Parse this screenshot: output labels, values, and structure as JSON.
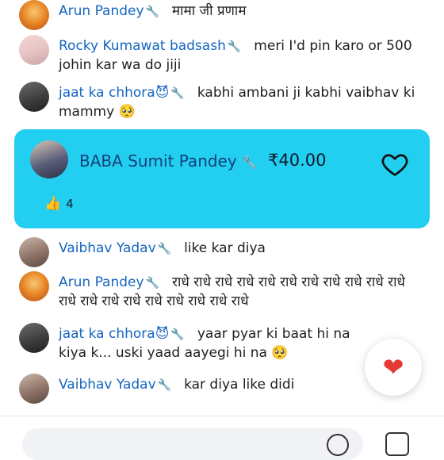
{
  "comments": [
    {
      "name": "Arun Pandey",
      "text": "मामा जी प्रणाम",
      "avatar": "avatar-deity-orange"
    },
    {
      "name": "Rocky Kumawat badsash",
      "text": "meri I'd pin karo or 500 johin kar wa do jiji",
      "avatar": "avatar-man-pink"
    },
    {
      "name": "jaat ka chhora😈",
      "text": "kabhi ambani ji kabhi vaibhav ki mammy 🥺",
      "avatar": "avatar-dark"
    },
    {
      "name": "Vaibhav Yadav",
      "text": "like kar diya",
      "avatar": "avatar-woman"
    },
    {
      "name": "Arun Pandey",
      "text": "राधे राधे राधे राधे राधे राधे राधे राधे राधे राधे राधे राधे राधे राधे राधे राधे राधे राधे राधे राधे",
      "avatar": "avatar-deity-orange"
    },
    {
      "name": "jaat ka chhora😈",
      "text": "yaar pyar ki baat hi na kiya k... uski yaad aayegi hi na 🥺",
      "avatar": "avatar-dark"
    },
    {
      "name": "Vaibhav Yadav",
      "text": "kar diya like didi",
      "avatar": "avatar-woman"
    }
  ],
  "paid_comment": {
    "name": "BABA Sumit Pandey",
    "amount": "₹40.00",
    "likes": "4",
    "avatar": "avatar-man-suit",
    "highlight_color": "#22cff0"
  },
  "badge_icon": "wrench-icon",
  "floating_reaction": "heart",
  "colors": {
    "name": "#1565c0",
    "accent": "#22cff0",
    "heart": "#e53935"
  }
}
